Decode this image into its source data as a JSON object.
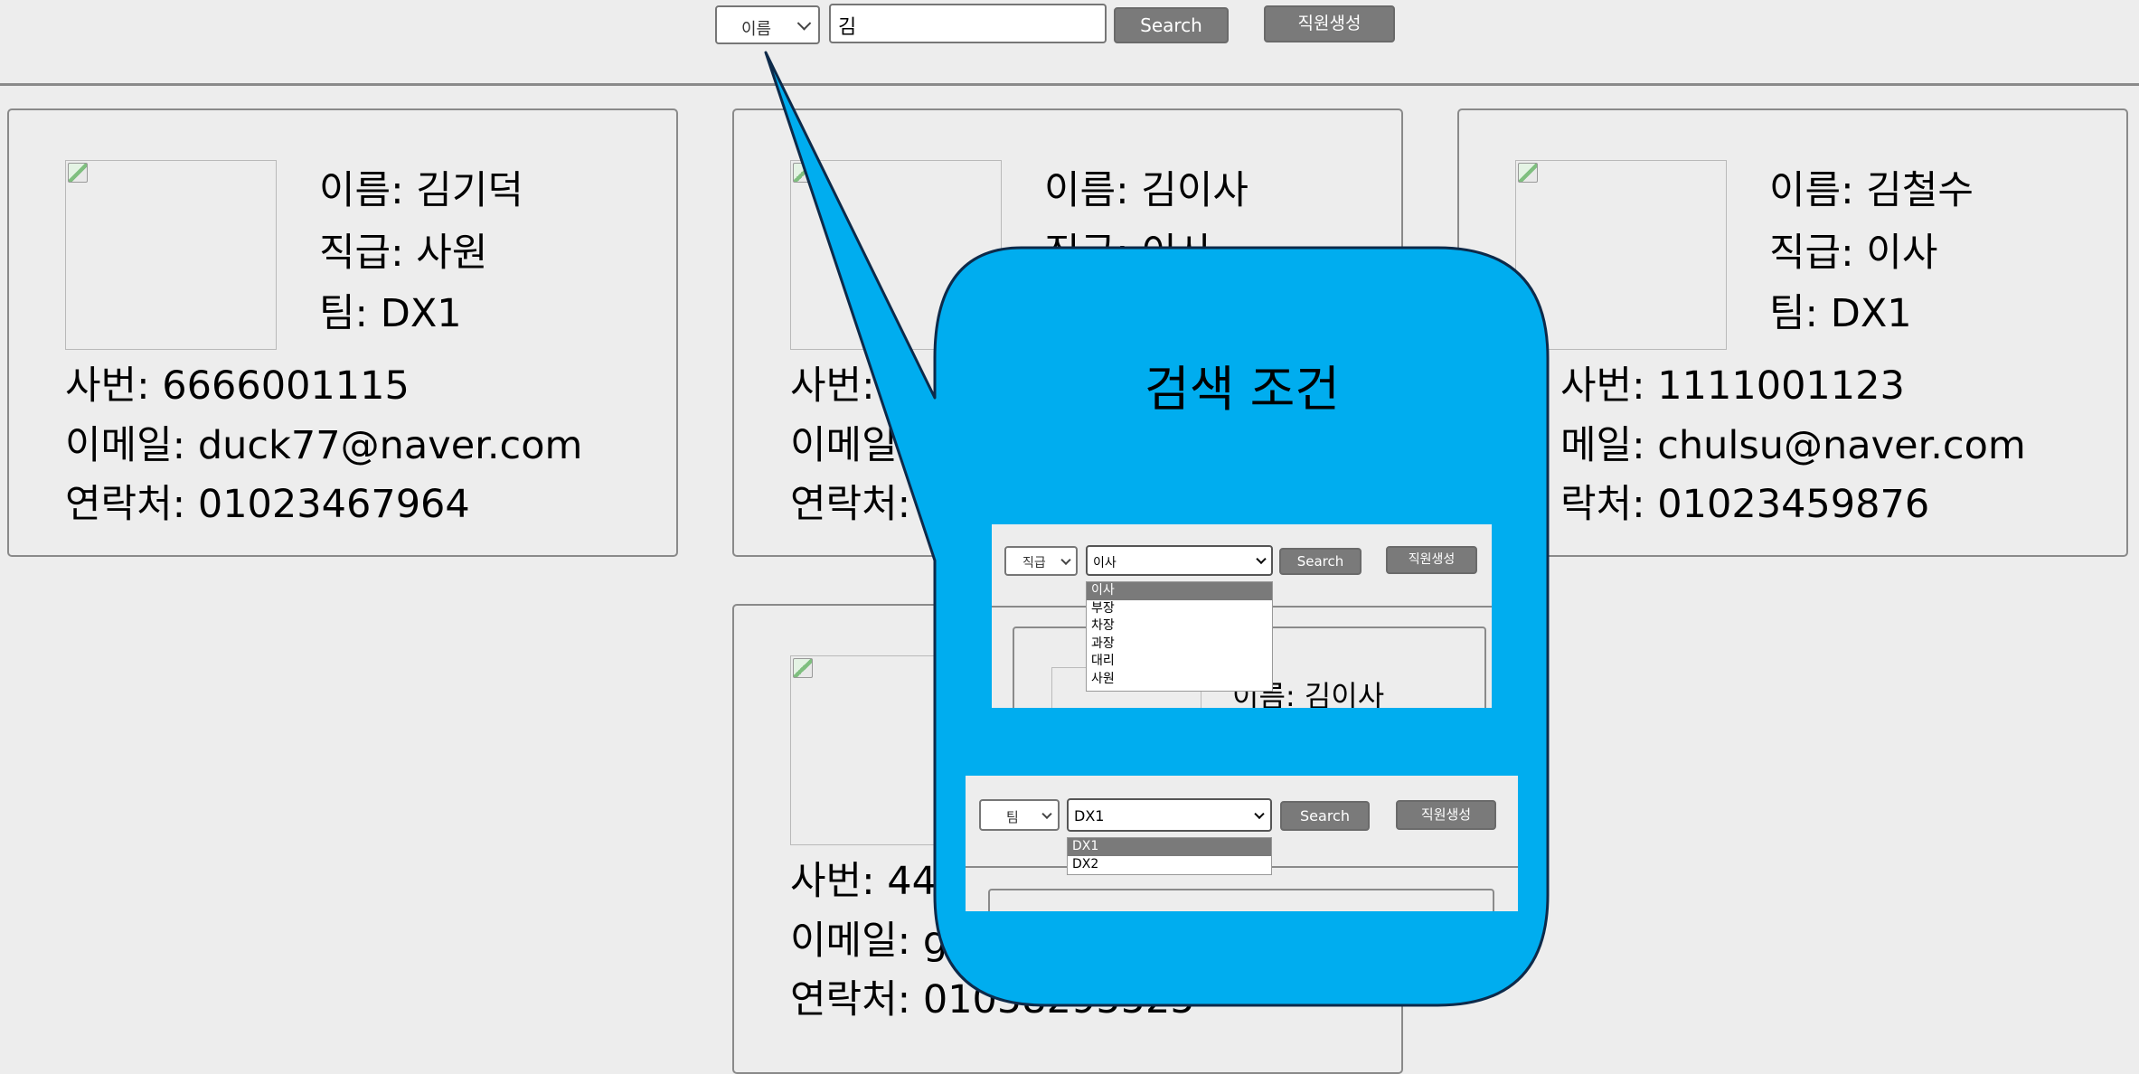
{
  "toolbar": {
    "filter_select": "이름",
    "search_value": "김",
    "search_label": "Search",
    "create_label": "직원생성"
  },
  "employees": [
    {
      "name": "이름: 김기덕",
      "rank": "직급: 사원",
      "team": "팀: DX1",
      "emp_no": "사번: 6666001115",
      "email": "이메일: duck77@naver.com",
      "phone": "연락처: 01023467964"
    },
    {
      "name": "이름: 김이사",
      "rank": "직급: 이사",
      "team": "",
      "emp_no": "사번:",
      "email": "이메일",
      "phone": "연락처:"
    },
    {
      "name": "이름: 김철수",
      "rank": "직급: 이사",
      "team": "팀: DX1",
      "emp_no": "사번: 1111001123",
      "email": "메일: chulsu@naver.com",
      "phone": "락처: 01023459876"
    },
    {
      "name": "",
      "rank": "",
      "team": "",
      "emp_no": "사번: 44",
      "email": "이메일: g",
      "phone": "연락처: 01058295525"
    }
  ],
  "callout": {
    "title": "검색 조건",
    "color": "#00adef",
    "rank_example": {
      "filter_select": "직급",
      "value_select": "이사",
      "search_label": "Search",
      "create_label": "직원생성",
      "options": [
        "이사",
        "부장",
        "차장",
        "과장",
        "대리",
        "사원"
      ],
      "card_name": "이름: 김이사"
    },
    "team_example": {
      "filter_select": "팀",
      "value_select": "DX1",
      "search_label": "Search",
      "create_label": "직원생성",
      "options": [
        "DX1",
        "DX2"
      ]
    }
  },
  "icons": {
    "photo": "broken-image-icon",
    "dropdown": "chevron-down-icon"
  }
}
